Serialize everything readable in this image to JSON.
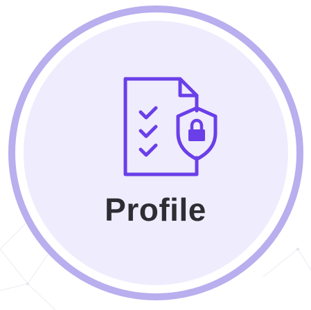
{
  "badge": {
    "label": "Profile",
    "icon": "document-checklist-shield-lock-icon"
  },
  "colors": {
    "accent": "#6a3fe8",
    "ring": "#b9aeee",
    "inner_fill": "#efecfd",
    "text": "#2f2d34"
  }
}
